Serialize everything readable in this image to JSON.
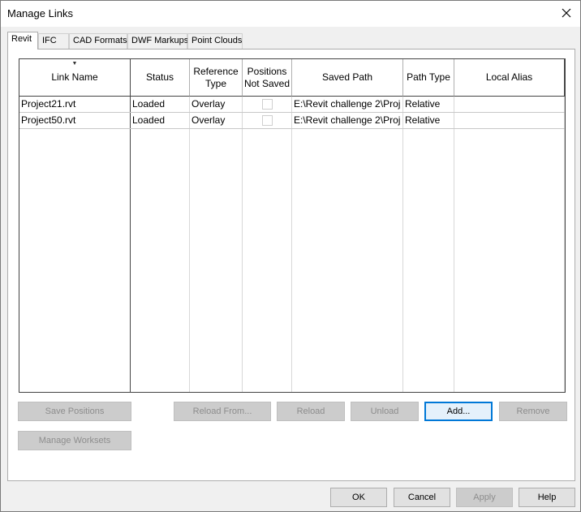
{
  "window": {
    "title": "Manage Links"
  },
  "tabs": [
    {
      "label": "Revit",
      "active": true
    },
    {
      "label": "IFC",
      "active": false
    },
    {
      "label": "CAD Formats",
      "active": false
    },
    {
      "label": "DWF Markups",
      "active": false
    },
    {
      "label": "Point Clouds",
      "active": false
    }
  ],
  "table": {
    "columns": [
      {
        "label": "Link Name",
        "sorted": true
      },
      {
        "label": "Status"
      },
      {
        "label": "Reference Type"
      },
      {
        "label": "Positions Not Saved"
      },
      {
        "label": "Saved Path"
      },
      {
        "label": "Path Type"
      },
      {
        "label": "Local Alias"
      }
    ],
    "rows": [
      {
        "link_name": "Project21.rvt",
        "status": "Loaded",
        "reference_type": "Overlay",
        "positions_not_saved": false,
        "saved_path": "E:\\Revit challenge 2\\Proj",
        "path_type": "Relative",
        "local_alias": ""
      },
      {
        "link_name": "Project50.rvt",
        "status": "Loaded",
        "reference_type": "Overlay",
        "positions_not_saved": false,
        "saved_path": "E:\\Revit challenge 2\\Proj",
        "path_type": "Relative",
        "local_alias": ""
      }
    ]
  },
  "actions": {
    "save_positions": {
      "label": "Save Positions",
      "enabled": false
    },
    "reload_from": {
      "label": "Reload From...",
      "enabled": false
    },
    "reload": {
      "label": "Reload",
      "enabled": false
    },
    "unload": {
      "label": "Unload",
      "enabled": false
    },
    "add": {
      "label": "Add...",
      "enabled": true
    },
    "remove": {
      "label": "Remove",
      "enabled": false
    },
    "manage_worksets": {
      "label": "Manage Worksets",
      "enabled": false
    }
  },
  "footer": {
    "ok": {
      "label": "OK",
      "enabled": true
    },
    "cancel": {
      "label": "Cancel",
      "enabled": true
    },
    "apply": {
      "label": "Apply",
      "enabled": false
    },
    "help": {
      "label": "Help",
      "enabled": true
    }
  },
  "colors": {
    "focus_border": "#0078d7",
    "disabled_bg": "#cccccc",
    "disabled_text": "#8d8d8d"
  }
}
